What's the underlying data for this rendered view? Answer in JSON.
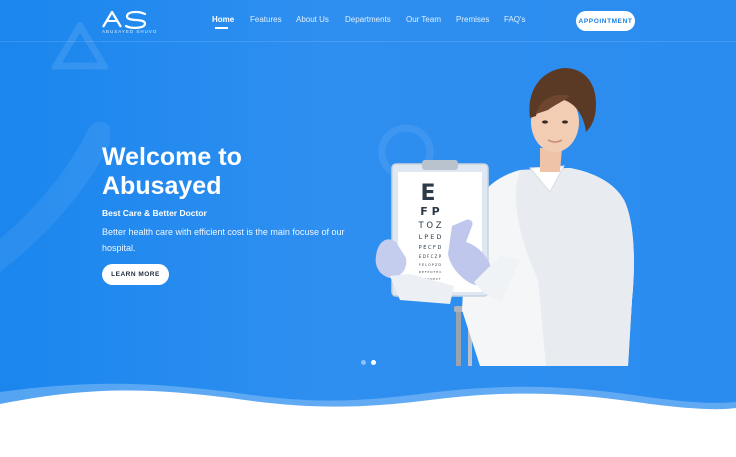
{
  "brand": {
    "logo_text": "AS",
    "logo_subtitle": "ABUSAYED SHUVO"
  },
  "nav": {
    "items": [
      {
        "label": "Home",
        "active": true
      },
      {
        "label": "Features",
        "active": false
      },
      {
        "label": "About Us",
        "active": false
      },
      {
        "label": "Departments",
        "active": false
      },
      {
        "label": "Our Team",
        "active": false
      },
      {
        "label": "Premises",
        "active": false
      },
      {
        "label": "FAQ's",
        "active": false
      }
    ],
    "appointment_label": "APPOINTMENT"
  },
  "hero": {
    "title": "Welcome to Abusayed",
    "subtitle": "Best Care & Better Doctor",
    "description": "Better health care with efficient cost is the main focuse of our hospital.",
    "cta_label": "LEARN MORE"
  },
  "eye_chart": {
    "letters": [
      "E",
      "F P",
      "T O Z",
      "L P E D",
      "P E C F D",
      "E D F C Z P",
      "F E L O P Z D",
      "D E F P O T E C",
      "L E F O D P C T",
      "F D P L T C E O",
      "P E Z O L C F T D"
    ]
  },
  "slider": {
    "slide_count": 2,
    "active_index": 1
  },
  "colors": {
    "primary": "#1a86ee",
    "white": "#ffffff",
    "button_text": "#1a7fe6"
  }
}
